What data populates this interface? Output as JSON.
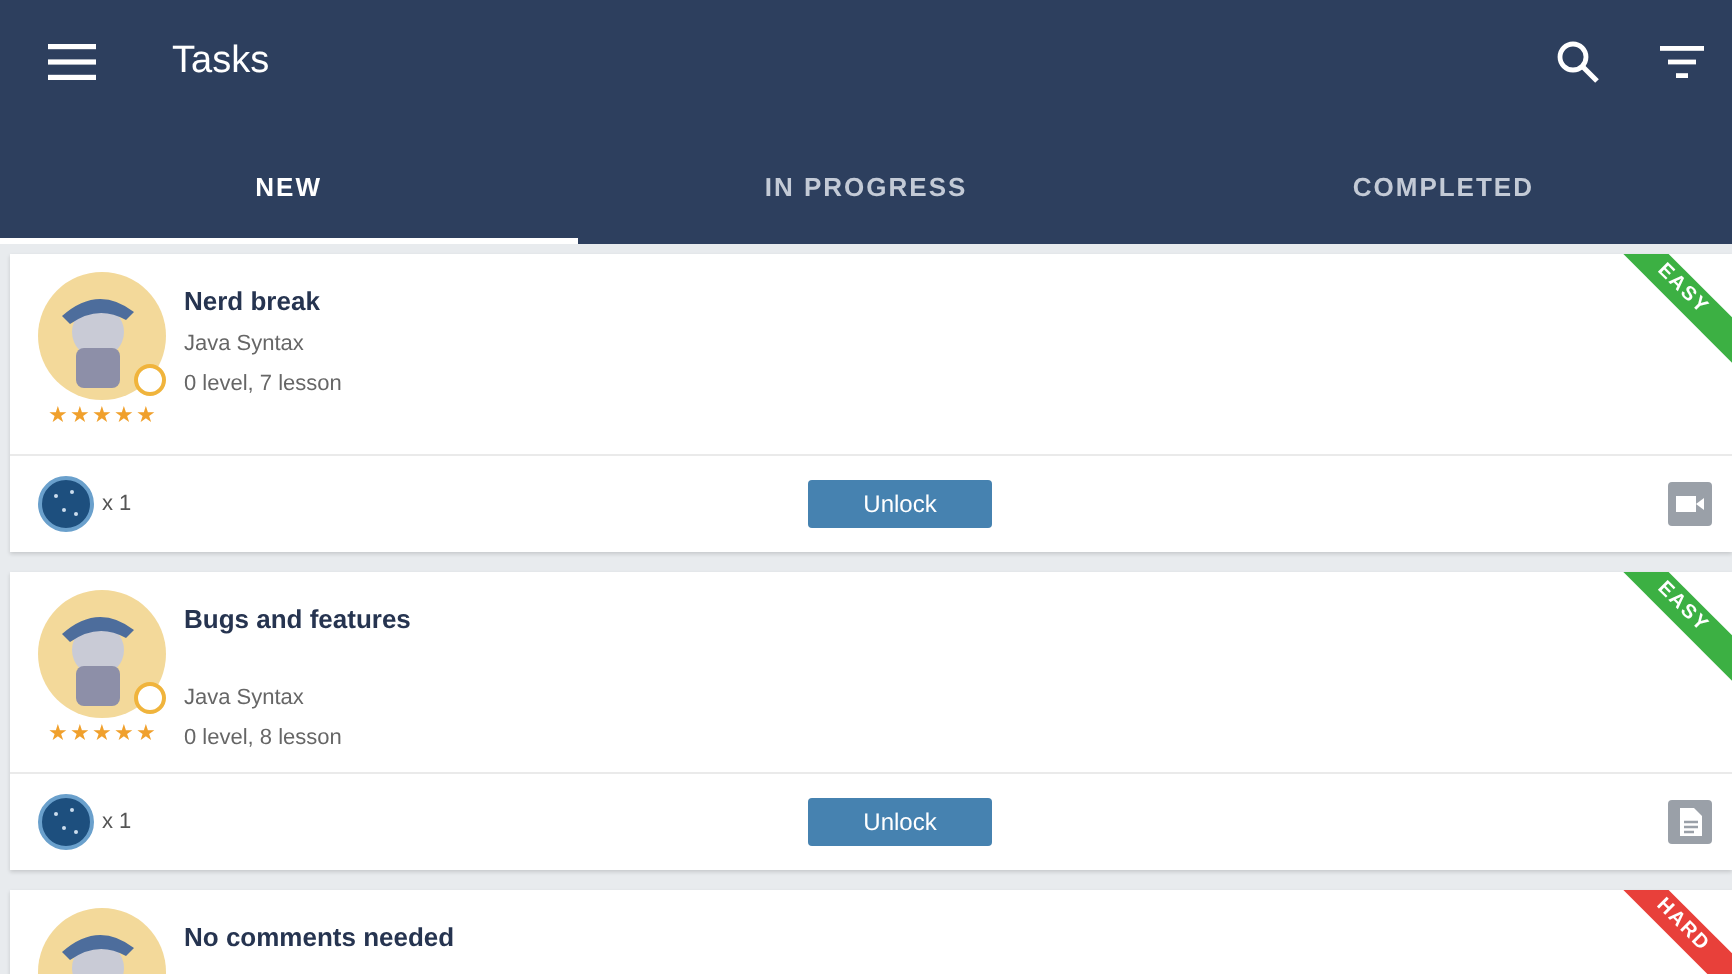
{
  "app_bar": {
    "title": "Tasks"
  },
  "tabs": [
    {
      "label": "NEW",
      "selected": true
    },
    {
      "label": "IN PROGRESS",
      "selected": false
    },
    {
      "label": "COMPLETED",
      "selected": false
    }
  ],
  "tasks": [
    {
      "title": "Nerd break",
      "course": "Java Syntax",
      "lesson": "0 level, 7 lesson",
      "stars": 5,
      "difficulty": "EASY",
      "color": "#3cb043",
      "reward": "x 1",
      "action": "Unlock",
      "kind": "video"
    },
    {
      "title": "Bugs and features",
      "course": "Java Syntax",
      "lesson": "0 level, 8 lesson",
      "stars": 5,
      "difficulty": "EASY",
      "color": "#3cb043",
      "reward": "x 1",
      "action": "Unlock",
      "kind": "document"
    },
    {
      "title": "No comments needed",
      "difficulty": "HARD",
      "color": "#e8403a"
    }
  ]
}
